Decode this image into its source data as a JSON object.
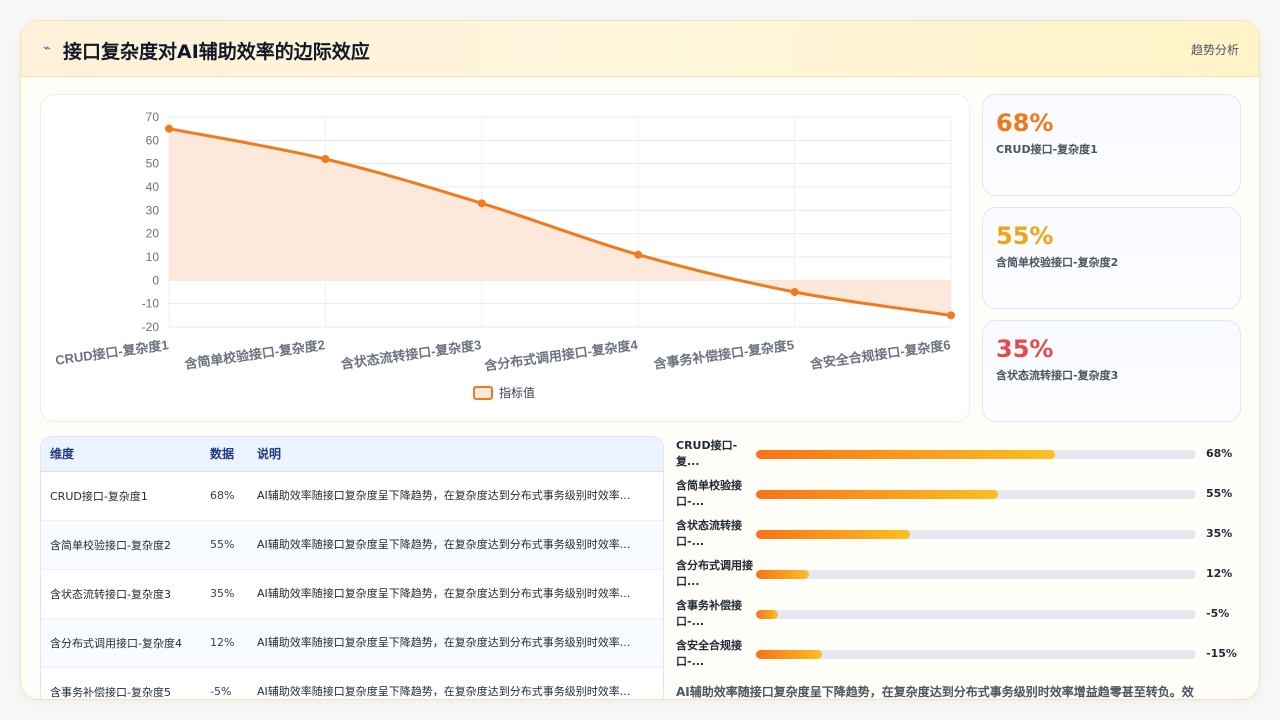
{
  "header": {
    "icon": "trend-icon",
    "title": "接口复杂度对AI辅助效率的边际效应",
    "tag": "趋势分析"
  },
  "colors": {
    "line": "#f07a1e",
    "area": "#fde7d8",
    "stat1": "#f0771a",
    "stat2": "#f0a516",
    "stat3": "#e84a4a"
  },
  "chart_data": {
    "type": "area",
    "categories": [
      "CRUD接口-复杂度1",
      "含简单校验接口-复杂度2",
      "含状态流转接口-复杂度3",
      "含分布式调用接口-复杂度4",
      "含事务补偿接口-复杂度5",
      "含安全合规接口-复杂度6"
    ],
    "series": [
      {
        "name": "指标值",
        "values": [
          65,
          52,
          33,
          11,
          -5,
          -15
        ]
      }
    ],
    "y_ticks": [
      70,
      60,
      50,
      40,
      30,
      20,
      10,
      0,
      -10,
      -20
    ],
    "ylim": [
      -20,
      70
    ],
    "grid": true,
    "legend": "bottom",
    "smooth": true
  },
  "stats": [
    {
      "value": "68%",
      "label": "CRUD接口-复杂度1"
    },
    {
      "value": "55%",
      "label": "含简单校验接口-复杂度2"
    },
    {
      "value": "35%",
      "label": "含状态流转接口-复杂度3"
    }
  ],
  "table": {
    "headers": [
      "维度",
      "数据",
      "说明"
    ],
    "rows": [
      {
        "dim": "CRUD接口-复杂度1",
        "data": "68%",
        "desc": "AI辅助效率随接口复杂度呈下降趋势，在复杂度达到分布式事务级别时效率..."
      },
      {
        "dim": "含简单校验接口-复杂度2",
        "data": "55%",
        "desc": "AI辅助效率随接口复杂度呈下降趋势，在复杂度达到分布式事务级别时效率..."
      },
      {
        "dim": "含状态流转接口-复杂度3",
        "data": "35%",
        "desc": "AI辅助效率随接口复杂度呈下降趋势，在复杂度达到分布式事务级别时效率..."
      },
      {
        "dim": "含分布式调用接口-复杂度4",
        "data": "12%",
        "desc": "AI辅助效率随接口复杂度呈下降趋势，在复杂度达到分布式事务级别时效率..."
      },
      {
        "dim": "含事务补偿接口-复杂度5",
        "data": "-5%",
        "desc": "AI辅助效率随接口复杂度呈下降趋势，在复杂度达到分布式事务级别时效率..."
      }
    ]
  },
  "bars": [
    {
      "label": "CRUD接口-复...",
      "value": "68%",
      "fraction": 0.68
    },
    {
      "label": "含简单校验接口-...",
      "value": "55%",
      "fraction": 0.55
    },
    {
      "label": "含状态流转接口-...",
      "value": "35%",
      "fraction": 0.35
    },
    {
      "label": "含分布式调用接口...",
      "value": "12%",
      "fraction": 0.12
    },
    {
      "label": "含事务补偿接口-...",
      "value": "-5%",
      "fraction": 0.05
    },
    {
      "label": "含安全合规接口-...",
      "value": "-15%",
      "fraction": 0.15
    }
  ],
  "summary": "AI辅助效率随接口复杂度呈下降趋势，在复杂度达到分布式事务级别时效率增益趋零甚至转负。效"
}
